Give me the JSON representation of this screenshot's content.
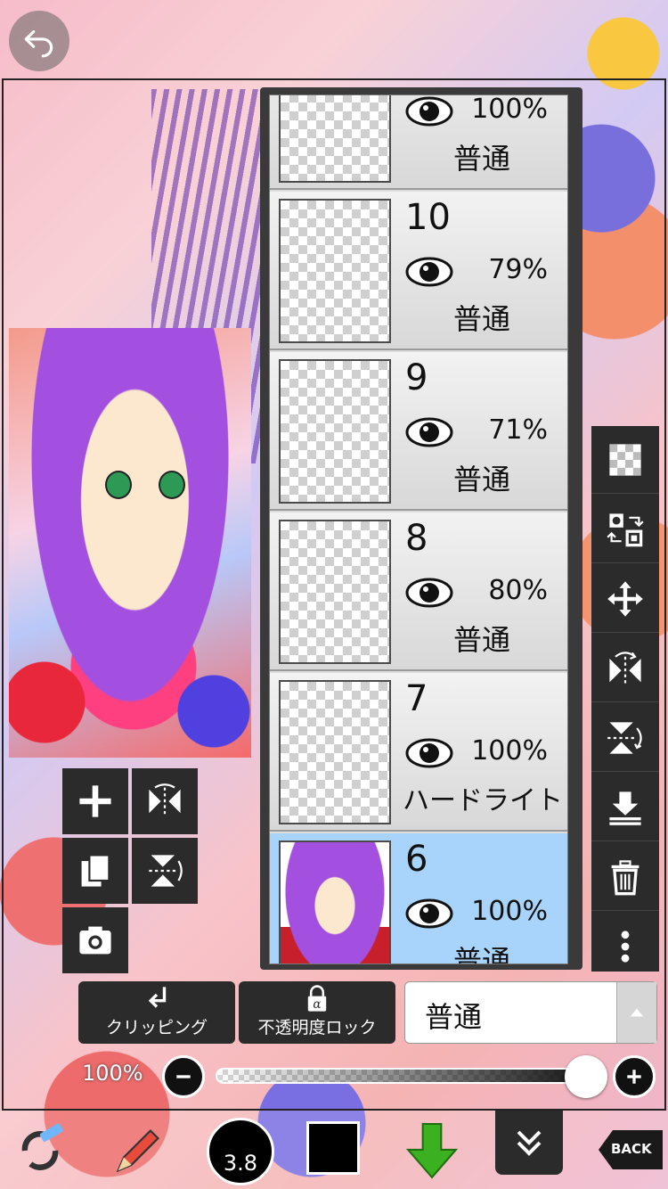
{
  "toolbar_top": {
    "undo_icon": "undo-icon"
  },
  "layers": [
    {
      "number": "",
      "opacity": "100%",
      "blend": "普通",
      "visible": true,
      "selected": false
    },
    {
      "number": "10",
      "opacity": "79%",
      "blend": "普通",
      "visible": true,
      "selected": false
    },
    {
      "number": "9",
      "opacity": "71%",
      "blend": "普通",
      "visible": true,
      "selected": false
    },
    {
      "number": "8",
      "opacity": "80%",
      "blend": "普通",
      "visible": true,
      "selected": false
    },
    {
      "number": "7",
      "opacity": "100%",
      "blend": "ハードライト",
      "visible": true,
      "selected": false
    },
    {
      "number": "6",
      "opacity": "100%",
      "blend": "普通",
      "visible": true,
      "selected": true
    }
  ],
  "layer_controls": {
    "clipping_label": "クリッピング",
    "alpha_lock_label": "不透明度ロック",
    "blend_mode": "普通"
  },
  "opacity": {
    "label": "100%",
    "value": 1.0
  },
  "brush": {
    "size_label": "3.8"
  },
  "colors": {
    "primary": "#000000",
    "selected_layer": "#a8d4fb"
  },
  "bottom": {
    "back_label": "BACK"
  }
}
